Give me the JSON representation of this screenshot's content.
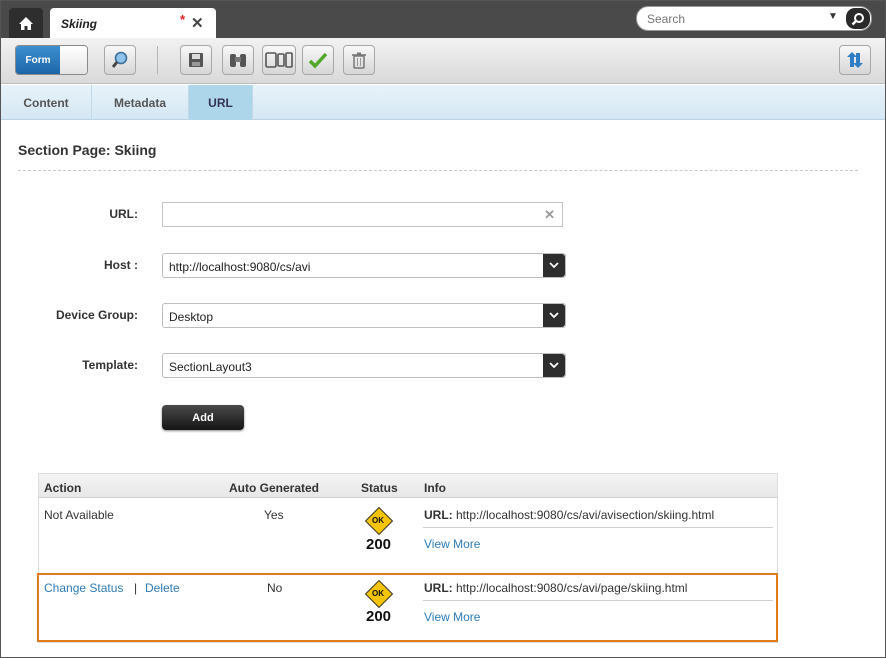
{
  "doc_tab": {
    "title": "Skiing",
    "dirty_marker": "*"
  },
  "search": {
    "placeholder": "Search"
  },
  "toolbar": {
    "form_toggle_label": "Form"
  },
  "subtabs": [
    "Content",
    "Metadata",
    "URL"
  ],
  "active_subtab": "URL",
  "page": {
    "section_title": "Section Page: Skiing"
  },
  "form": {
    "url_label": "URL:",
    "url_value": "",
    "host_label": "Host :",
    "host_value": "http://localhost:9080/cs/avi",
    "device_group_label": "Device Group:",
    "device_group_value": "Desktop",
    "template_label": "Template:",
    "template_value": "SectionLayout3",
    "add_label": "Add"
  },
  "table": {
    "headers": [
      "Action",
      "Auto Generated",
      "Status",
      "Info"
    ],
    "rows": [
      {
        "action": "Not Available",
        "auto_generated": "Yes",
        "status_badge": "OK",
        "status_code": "200",
        "url_label": "URL:",
        "url": "http://localhost:9080/cs/avi/avisection/skiing.html",
        "view_more": "View More"
      },
      {
        "action_links": [
          "Change Status",
          "Delete"
        ],
        "separator": "|",
        "auto_generated": "No",
        "status_badge": "OK",
        "status_code": "200",
        "url_label": "URL:",
        "url": "http://localhost:9080/cs/avi/page/skiing.html",
        "view_more": "View More"
      }
    ]
  },
  "colors": {
    "highlight": "#e07b1c",
    "link": "#2e7cb7",
    "status_ok": "#f5c400"
  }
}
